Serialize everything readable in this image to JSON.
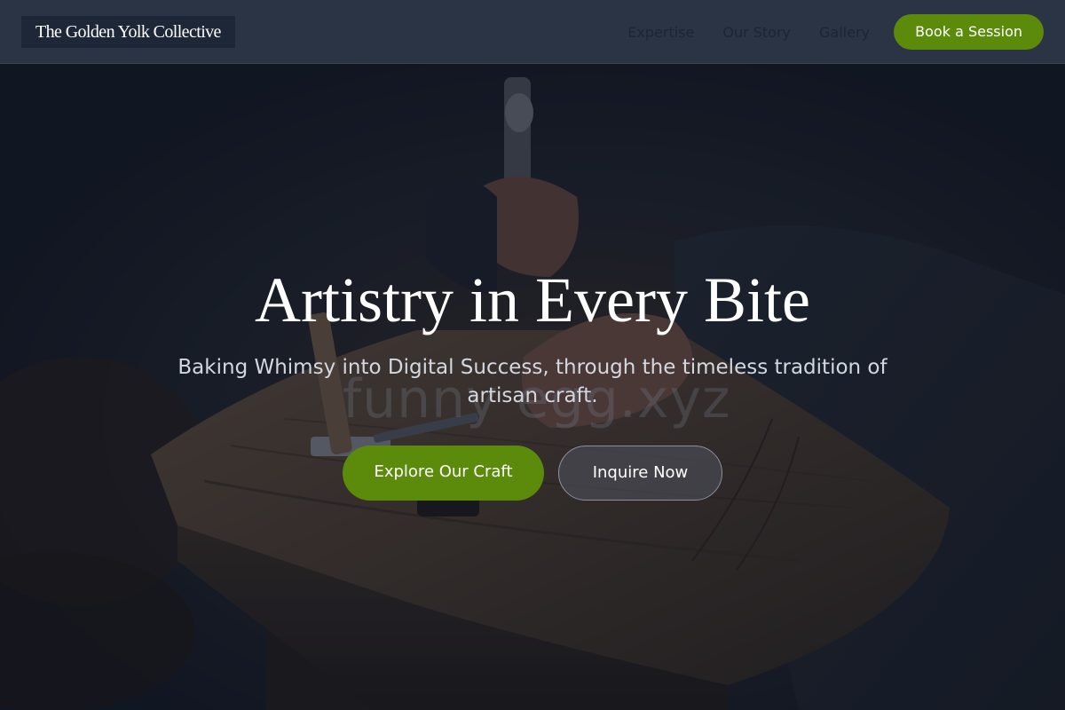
{
  "header": {
    "logo_text": "The Golden Yolk Collective",
    "nav": [
      {
        "label": "Expertise"
      },
      {
        "label": "Our Story"
      },
      {
        "label": "Gallery"
      }
    ],
    "cta_label": "Book a Session"
  },
  "hero": {
    "title": "Artistry in Every Bite",
    "subtitle": "Baking Whimsy into Digital Success, through the timeless tradition of artisan craft.",
    "watermark_text": "funny egg.xyz",
    "primary_button": "Explore Our Craft",
    "secondary_button": "Inquire Now",
    "background_image": "craftsman-hammering-on-wooden-workbench"
  },
  "colors": {
    "header_bg": "#2a3445",
    "accent_green": "#5c8a0b",
    "overlay": "#0f1726",
    "title_text": "#ffffff",
    "subtitle_text": "#d3d8e0"
  }
}
